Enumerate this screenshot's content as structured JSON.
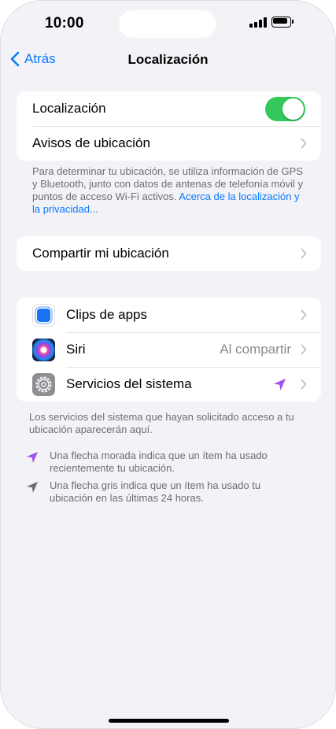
{
  "status_bar": {
    "time": "10:00"
  },
  "nav": {
    "back_label": "Atrás",
    "title": "Localización"
  },
  "location_group": {
    "location_label": "Localización",
    "location_enabled": true,
    "alerts_label": "Avisos de ubicación"
  },
  "location_footer": {
    "text": "Para determinar tu ubicación, se utiliza información de GPS y Bluetooth, junto con datos de antenas de telefonía móvil y puntos de acceso Wi-Fi activos. ",
    "link": "Acerca de la localización y la privacidad..."
  },
  "share_group": {
    "share_label": "Compartir mi ubicación"
  },
  "apps_group": {
    "items": [
      {
        "label": "Clips de apps",
        "icon": "app-clips-icon"
      },
      {
        "label": "Siri",
        "icon": "siri-icon",
        "value": "Al compartir"
      },
      {
        "label": "Servicios del sistema",
        "icon": "settings-gear-icon",
        "status_icon": "purple-location-arrow-icon"
      }
    ]
  },
  "apps_footer": {
    "text": "Los servicios del sistema que hayan solicitado acceso a tu ubicación aparecerán aquí."
  },
  "legend": {
    "purple": "Una flecha morada indica que un ítem ha usado recientemente tu ubicación.",
    "gray": "Una flecha gris indica que un ítem ha usado tu ubicación en las últimas 24 horas."
  },
  "colors": {
    "accent": "#0a7aff",
    "toggle_on": "#34c759",
    "purple_arrow": "#a54ff0",
    "gray_arrow": "#6e6e73",
    "background": "#f2f2f7"
  }
}
